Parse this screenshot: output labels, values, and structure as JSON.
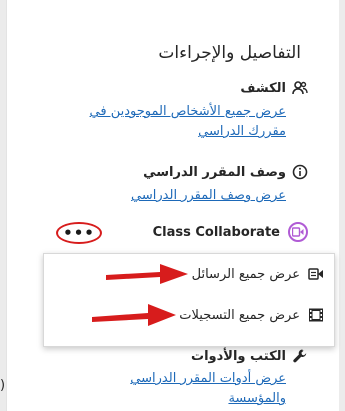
{
  "panel": {
    "title": "التفاصيل والإجراءات"
  },
  "roster": {
    "heading": "الكشف",
    "link_line1": "عرض جميع الأشخاص الموجودين في",
    "link_line2": "مقررك الدراسي",
    "icon": "people-icon"
  },
  "description": {
    "heading": "وصف المقرر الدراسي",
    "link": "عرض وصف المقرر الدراسي",
    "icon": "info-icon"
  },
  "collaborate": {
    "label": "Class Collaborate",
    "more_label": "•••",
    "icon": "collaborate-icon"
  },
  "menu": {
    "items": [
      {
        "label": "عرض جميع الرسائل",
        "icon": "messages-icon"
      },
      {
        "label": "عرض جميع التسجيلات",
        "icon": "recordings-icon"
      }
    ]
  },
  "tools": {
    "heading": "الكتب والأدوات",
    "link_line1": "عرض أدوات المقرر الدراسي",
    "link_line2": "والمؤسسة",
    "icon": "wrench-icon",
    "edge_text": ")"
  },
  "colors": {
    "link": "#1d69b8",
    "annotation_red": "#d71c1c",
    "collaborate_purple": "#b05bd5"
  }
}
